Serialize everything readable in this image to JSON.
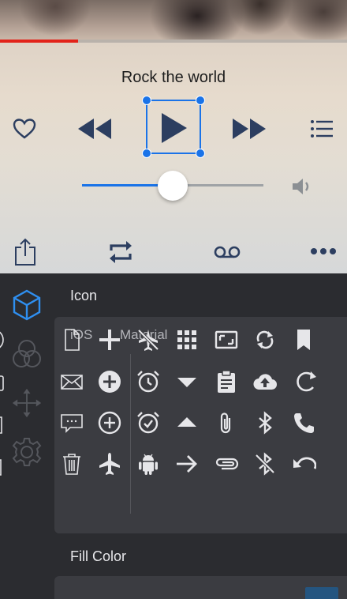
{
  "player": {
    "song_title": "Rock the world",
    "playback_progress": 0.225,
    "volume_level": 0.5,
    "accent_color": "#1a73e8",
    "progress_color": "#e2231a",
    "controls": [
      "heart-icon",
      "rewind-icon",
      "play-icon",
      "fast-forward-icon",
      "list-icon"
    ],
    "bottom_bar": [
      "share-icon",
      "repeat-icon",
      "voicemail-icon",
      "more-icon"
    ]
  },
  "editor": {
    "tools": [
      "cube-icon",
      "color-circles-icon",
      "move-arrows-icon",
      "gear-icon"
    ],
    "icon_section_title": "Icon",
    "tabs": [
      "iOS",
      "Material"
    ],
    "ios_icons": [
      [
        "airplane-circle-icon",
        "document-icon"
      ],
      [
        "camera-icon",
        "mail-icon"
      ],
      [
        "download-icon",
        "chat-icon"
      ],
      [
        "share-icon",
        "trash-icon"
      ]
    ],
    "material_icons": [
      [
        "plus-icon",
        "airplane-off-icon",
        "apps-grid-icon",
        "picture-in-picture-icon",
        "sync-icon",
        "bookmark-icon"
      ],
      [
        "add-circle-icon",
        "alarm-icon",
        "arrow-drop-down-icon",
        "clipboard-icon",
        "cloud-upload-icon",
        "rotate-icon"
      ],
      [
        "add-circle-outline-icon",
        "alarm-on-icon",
        "arrow-drop-up-icon",
        "attachment-icon",
        "bluetooth-icon",
        "phone-icon"
      ],
      [
        "airplane-icon",
        "android-icon",
        "arrow-forward-icon",
        "attach-file-icon",
        "bluetooth-disabled-icon",
        "undo-icon"
      ]
    ],
    "fill_color_title": "Fill Color",
    "fill_color_value": "#245580"
  }
}
